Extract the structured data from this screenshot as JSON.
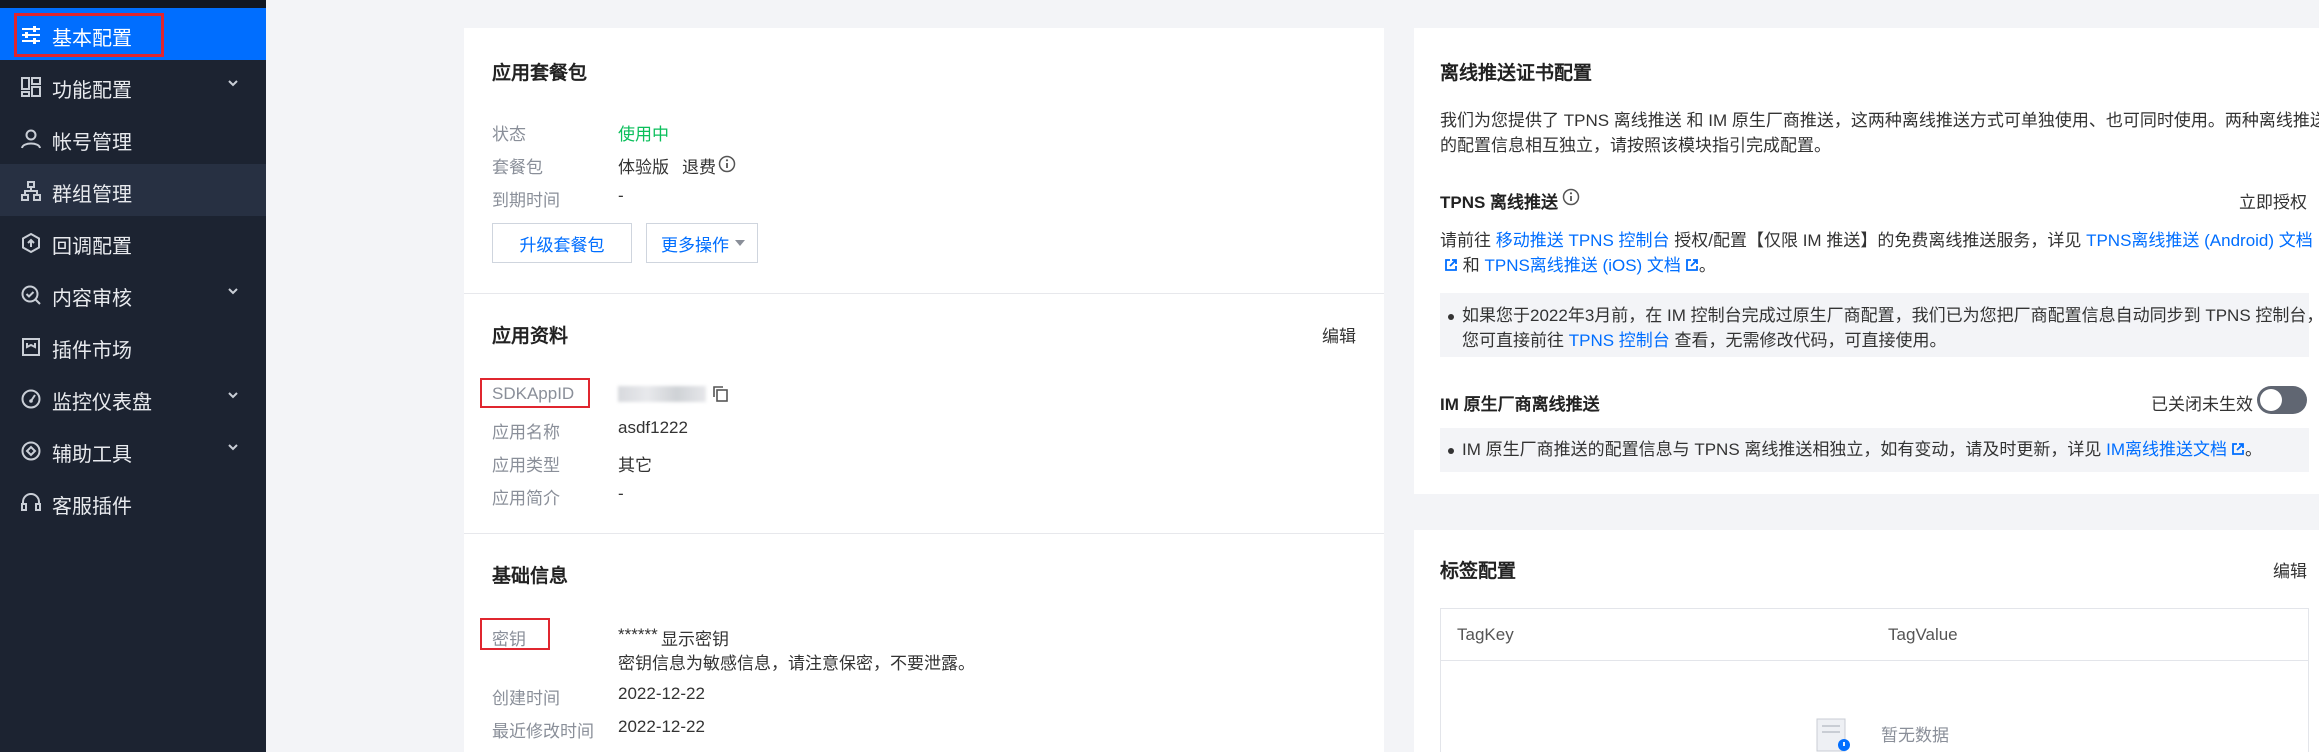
{
  "sidebar": {
    "items": [
      {
        "label": "基本配置",
        "icon": "sliders-icon"
      },
      {
        "label": "功能配置",
        "icon": "grid-icon"
      },
      {
        "label": "帐号管理",
        "icon": "user-icon"
      },
      {
        "label": "群组管理",
        "icon": "sitemap-icon"
      },
      {
        "label": "回调配置",
        "icon": "callback-icon"
      },
      {
        "label": "内容审核",
        "icon": "search-check-icon"
      },
      {
        "label": "插件市场",
        "icon": "plugin-icon"
      },
      {
        "label": "监控仪表盘",
        "icon": "gauge-icon"
      },
      {
        "label": "辅助工具",
        "icon": "tool-icon"
      },
      {
        "label": "客服插件",
        "icon": "headset-icon"
      }
    ]
  },
  "package": {
    "title": "应用套餐包",
    "status_label": "状态",
    "status_value": "使用中",
    "plan_label": "套餐包",
    "plan_value": "体验版",
    "refund_link": "退费",
    "expire_label": "到期时间",
    "expire_value": "-",
    "upgrade_button": "升级套餐包",
    "more_button": "更多操作"
  },
  "app_info": {
    "title": "应用资料",
    "edit_link": "编辑",
    "sdkappid_label": "SDKAppID",
    "name_label": "应用名称",
    "name_value": "asdf1222",
    "type_label": "应用类型",
    "type_value": "其它",
    "intro_label": "应用简介",
    "intro_value": "-"
  },
  "basic_info": {
    "title": "基础信息",
    "key_label": "密钥",
    "key_value": "******",
    "show_key_link": "显示密钥",
    "key_note": "密钥信息为敏感信息，请注意保密，不要泄露。",
    "created_label": "创建时间",
    "created_value": "2022-12-22",
    "modified_label": "最近修改时间",
    "modified_value": "2022-12-22"
  },
  "push": {
    "title": "离线推送证书配置",
    "intro_line1": "我们为您提供了 TPNS 离线推送 和 IM 原生厂商推送，这两种离线推送方式可单独使用、也可同时使用。两种离线推送",
    "intro_line2": "的配置信息相互独立，请按照该模块指引完成配置。",
    "tpns_title": "TPNS 离线推送",
    "authorize_link": "立即授权",
    "tpns_pre": "请前往",
    "tpns_console_link": "移动推送 TPNS 控制台",
    "tpns_mid": "授权/配置【仅限 IM 推送】的免费离线推送服务，详见",
    "tpns_android_link": "TPNS离线推送 (Android) 文档",
    "tpns_and": "和",
    "tpns_ios_link": "TPNS离线推送 (iOS) 文档",
    "tpns_end": "。",
    "note1_line1": "如果您于2022年3月前，在 IM 控制台完成过原生厂商配置，我们已为您把厂商配置信息自动同步到 TPNS 控制台，",
    "note1_pre": "您可直接前往",
    "note1_link": "TPNS 控制台",
    "note1_post": "查看，无需修改代码，可直接使用。",
    "im_title": "IM 原生厂商离线推送",
    "toggle_label": "已关闭未生效",
    "note2_text": "IM 原生厂商推送的配置信息与 TPNS 离线推送相独立，如有变动，请及时更新，详见",
    "note2_link": "IM离线推送文档",
    "note2_end": "。"
  },
  "tags": {
    "title": "标签配置",
    "edit_link": "编辑",
    "col_key": "TagKey",
    "col_value": "TagValue",
    "empty_text": "暂无数据"
  },
  "colors": {
    "accent": "#006eff",
    "success": "#0abf5b",
    "sidebar_bg": "#1c2331",
    "highlight_box": "#e0262f"
  }
}
